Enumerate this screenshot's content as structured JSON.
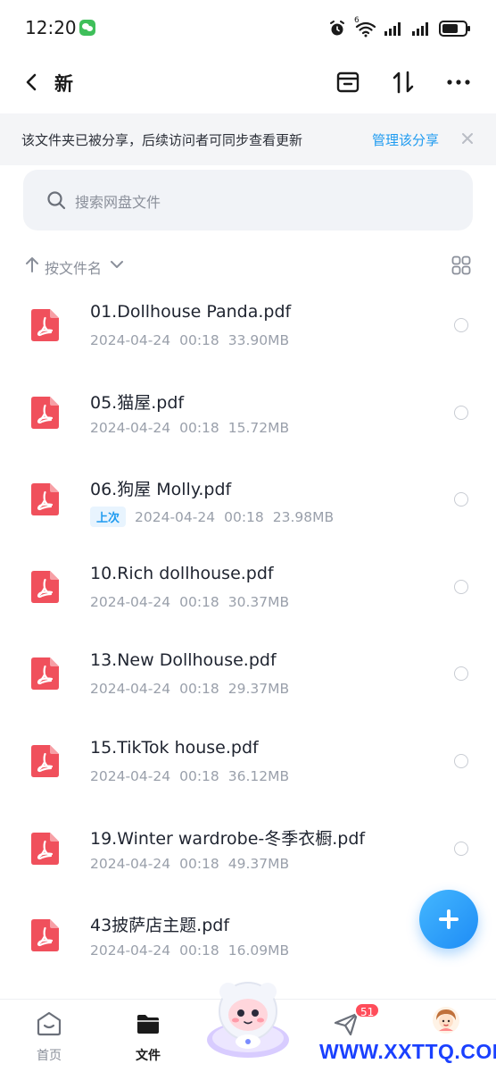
{
  "status_bar": {
    "time": "12:20",
    "network_superscript": "6"
  },
  "nav": {
    "title": "新",
    "actions": [
      "archive-icon",
      "sort-arrows-icon",
      "more-icon"
    ]
  },
  "share_banner": {
    "text": "该文件夹已被分享，后续访问者可同步查看更新",
    "manage_link": "管理该分享"
  },
  "search": {
    "placeholder": "搜索网盘文件"
  },
  "sort": {
    "label": "按文件名"
  },
  "files": [
    {
      "name": "01.Dollhouse Panda.pdf",
      "date": "2024-04-24",
      "time": "00:18",
      "size": "33.90MB",
      "badge": ""
    },
    {
      "name": "05.猫屋.pdf",
      "date": "2024-04-24",
      "time": "00:18",
      "size": "15.72MB",
      "badge": ""
    },
    {
      "name": "06.狗屋 Molly.pdf",
      "date": "2024-04-24",
      "time": "00:18",
      "size": "23.98MB",
      "badge": "上次"
    },
    {
      "name": "10.Rich dollhouse.pdf",
      "date": "2024-04-24",
      "time": "00:18",
      "size": "30.37MB",
      "badge": ""
    },
    {
      "name": "13.New Dollhouse.pdf",
      "date": "2024-04-24",
      "time": "00:18",
      "size": "29.37MB",
      "badge": ""
    },
    {
      "name": "15.TikTok house.pdf",
      "date": "2024-04-24",
      "time": "00:18",
      "size": "36.12MB",
      "badge": ""
    },
    {
      "name": "19.Winter wardrobe-冬季衣橱.pdf",
      "date": "2024-04-24",
      "time": "00:18",
      "size": "49.37MB",
      "badge": ""
    },
    {
      "name": "43披萨店主题.pdf",
      "date": "2024-04-24",
      "time": "00:18",
      "size": "16.09MB",
      "badge": ""
    }
  ],
  "tabs": {
    "home": "首页",
    "files": "文件",
    "messages_badge": "51"
  },
  "watermark": "WWW.XXTTQ.COM",
  "colors": {
    "accent": "#1f9bf0",
    "pdf_red": "#f0505c",
    "badge_red": "#ff4d5a"
  }
}
